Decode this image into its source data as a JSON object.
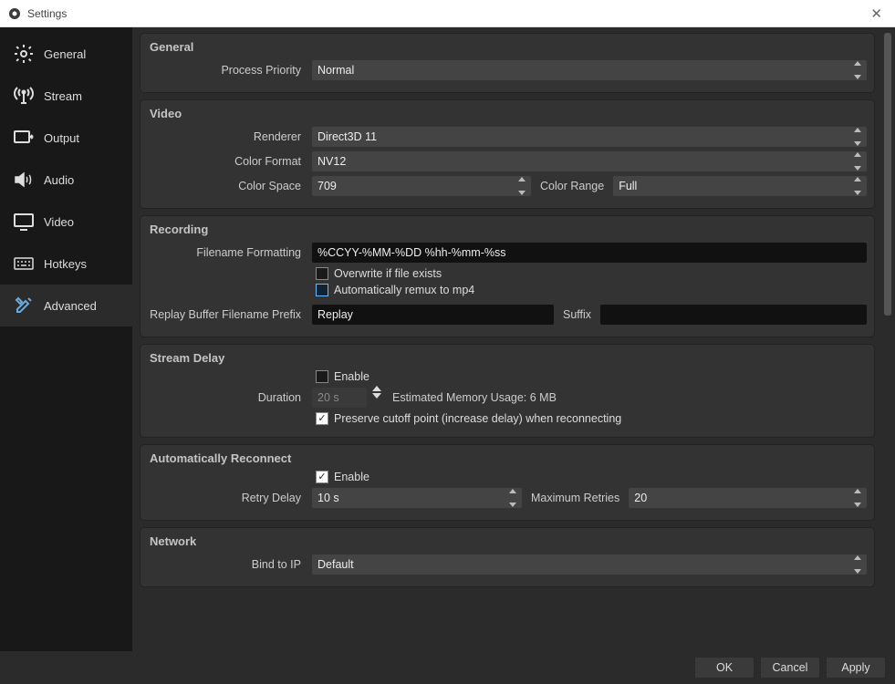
{
  "window": {
    "title": "Settings"
  },
  "sidebar": {
    "items": [
      {
        "label": "General"
      },
      {
        "label": "Stream"
      },
      {
        "label": "Output"
      },
      {
        "label": "Audio"
      },
      {
        "label": "Video"
      },
      {
        "label": "Hotkeys"
      },
      {
        "label": "Advanced"
      }
    ]
  },
  "general": {
    "title": "General",
    "process_priority_label": "Process Priority",
    "process_priority": "Normal"
  },
  "video": {
    "title": "Video",
    "renderer_label": "Renderer",
    "renderer": "Direct3D 11",
    "color_format_label": "Color Format",
    "color_format": "NV12",
    "color_space_label": "Color Space",
    "color_space": "709",
    "color_range_label": "Color Range",
    "color_range": "Full"
  },
  "recording": {
    "title": "Recording",
    "filename_label": "Filename Formatting",
    "filename": "%CCYY-%MM-%DD %hh-%mm-%ss",
    "overwrite_label": "Overwrite if file exists",
    "remux_label": "Automatically remux to mp4",
    "replay_prefix_label": "Replay Buffer Filename Prefix",
    "replay_prefix": "Replay",
    "suffix_label": "Suffix",
    "suffix": ""
  },
  "stream_delay": {
    "title": "Stream Delay",
    "enable_label": "Enable",
    "duration_label": "Duration",
    "duration": "20 s",
    "memory_text": "Estimated Memory Usage: 6 MB",
    "preserve_label": "Preserve cutoff point (increase delay) when reconnecting"
  },
  "reconnect": {
    "title": "Automatically Reconnect",
    "enable_label": "Enable",
    "retry_delay_label": "Retry Delay",
    "retry_delay": "10 s",
    "max_retries_label": "Maximum Retries",
    "max_retries": "20"
  },
  "network": {
    "title": "Network",
    "bind_label": "Bind to IP",
    "bind": "Default"
  },
  "footer": {
    "ok": "OK",
    "cancel": "Cancel",
    "apply": "Apply"
  }
}
